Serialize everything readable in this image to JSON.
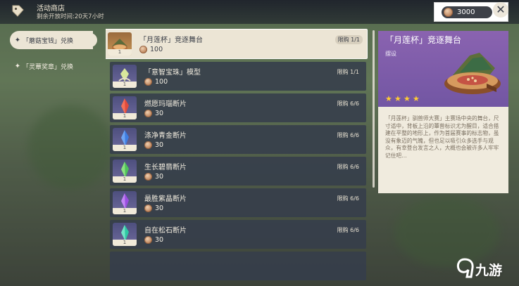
{
  "header": {
    "shop_title": "活动商店",
    "shop_time": "剩余开放时间:20天7小时"
  },
  "currency": {
    "value": "3000"
  },
  "tabs": [
    {
      "label": "「蘑菇宝钱」兑换",
      "active": true
    },
    {
      "label": "「灵蕈奖章」兑换",
      "active": false
    }
  ],
  "items": [
    {
      "name": "「月莲杯」竞逐舞台",
      "price": "100",
      "limit": "限购 1/1",
      "qty": "1",
      "icon": "stage-icon",
      "selected": true
    },
    {
      "name": "「意智宝珠」模型",
      "price": "100",
      "limit": "限购 1/1",
      "qty": "1",
      "icon": "orb-model-icon"
    },
    {
      "name": "燃愿玛瑙断片",
      "price": "30",
      "limit": "限购 6/6",
      "qty": "1",
      "icon": "agate-fragment-icon",
      "color": "#e04a3c"
    },
    {
      "name": "涤净青金断片",
      "price": "30",
      "limit": "限购 6/6",
      "qty": "1",
      "icon": "lazurite-fragment-icon",
      "color": "#3f7de0"
    },
    {
      "name": "生长碧翡断片",
      "price": "30",
      "limit": "限购 6/6",
      "qty": "1",
      "icon": "jade-fragment-icon",
      "color": "#4fc25a"
    },
    {
      "name": "最胜紫晶断片",
      "price": "30",
      "limit": "限购 6/6",
      "qty": "1",
      "icon": "amethyst-fragment-icon",
      "color": "#9a4ee0"
    },
    {
      "name": "自在松石断片",
      "price": "30",
      "limit": "限购 6/6",
      "qty": "1",
      "icon": "turquoise-fragment-icon",
      "color": "#2fc7a3"
    }
  ],
  "detail": {
    "title": "「月莲杯」竞逐舞台",
    "category": "摆设",
    "stars": 4,
    "description": "「月莲杯」驯兽师大赛」主赛场中央的舞台，尺寸适中，背板上沿的蕈兽标识尤为醒目，适合搭建在平整的地形上，作为首届赛事的标志物，虽没有象迈的气魄，但也足以吸引众多选手与观众，有幸登台发言之人，大概也会被许多人牢牢记住吧…"
  },
  "watermark": {
    "text": "九游"
  },
  "colors": {
    "accent_purple": "#7a5aa8",
    "panel_cream": "#ece5d5",
    "row_dark": "#363d4b",
    "star_gold": "#ffcc32"
  }
}
